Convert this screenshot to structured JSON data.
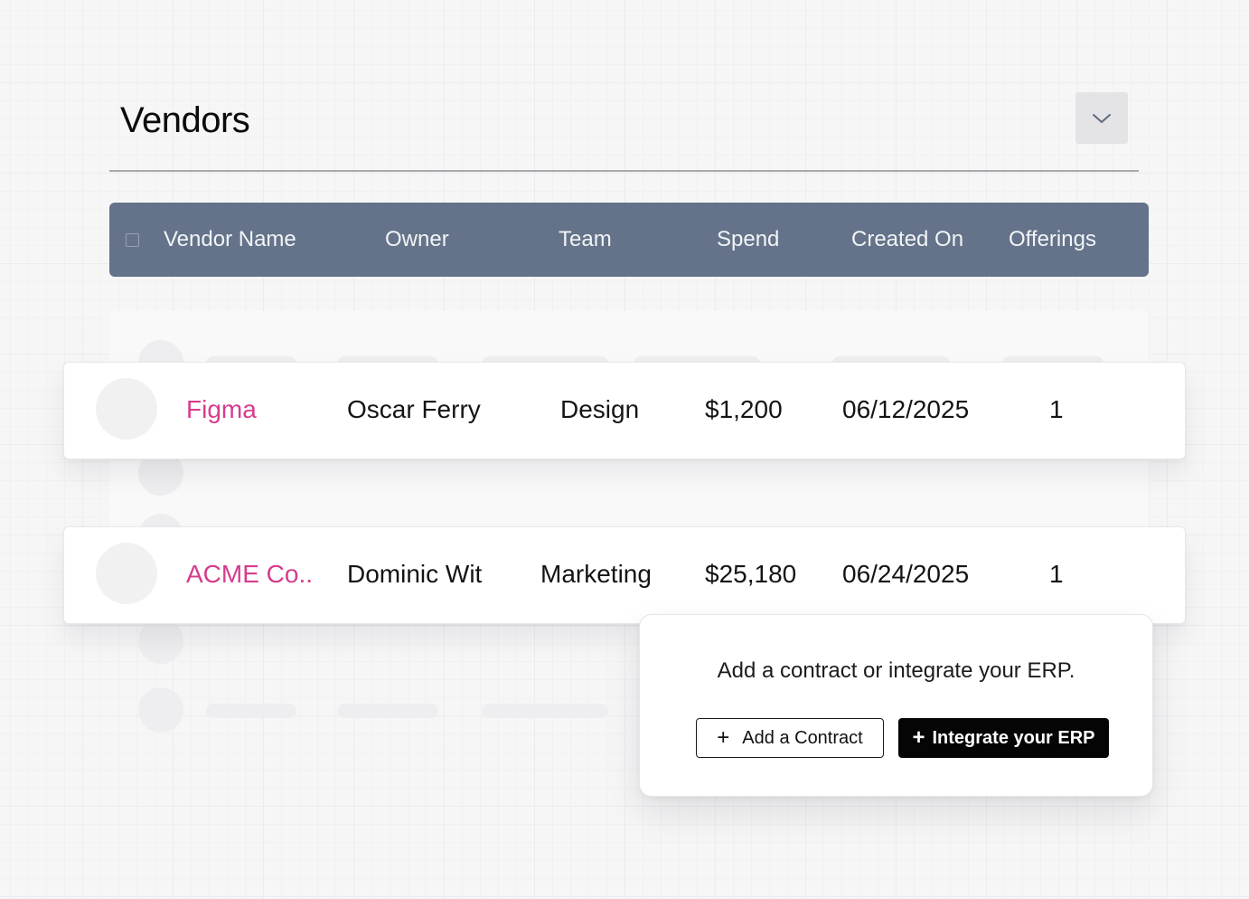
{
  "page": {
    "title": "Vendors"
  },
  "table": {
    "columns": [
      "Vendor Name",
      "Owner",
      "Team",
      "Spend",
      "Created On",
      "Offerings"
    ],
    "rows": [
      {
        "name": "Figma",
        "owner": "Oscar Ferry",
        "team": "Design",
        "spend": "$1,200",
        "created_on": "06/12/2025",
        "offerings": "1"
      },
      {
        "name": "ACME Co..",
        "owner": "Dominic Wit",
        "team": "Marketing",
        "spend": "$25,180",
        "created_on": "06/24/2025",
        "offerings": "1"
      }
    ]
  },
  "popover": {
    "message": "Add a contract or integrate your ERP.",
    "add_contract_label": "Add a Contract",
    "integrate_label": "Integrate your ERP",
    "plus_glyph": "+"
  },
  "colors": {
    "header_bg": "#647389",
    "vendor_name": "#d63d8d",
    "primary_button": "#050505"
  },
  "icons": {
    "collapse": "chevron-down-icon",
    "checkbox": "checkbox-icon",
    "add": "plus-icon"
  }
}
